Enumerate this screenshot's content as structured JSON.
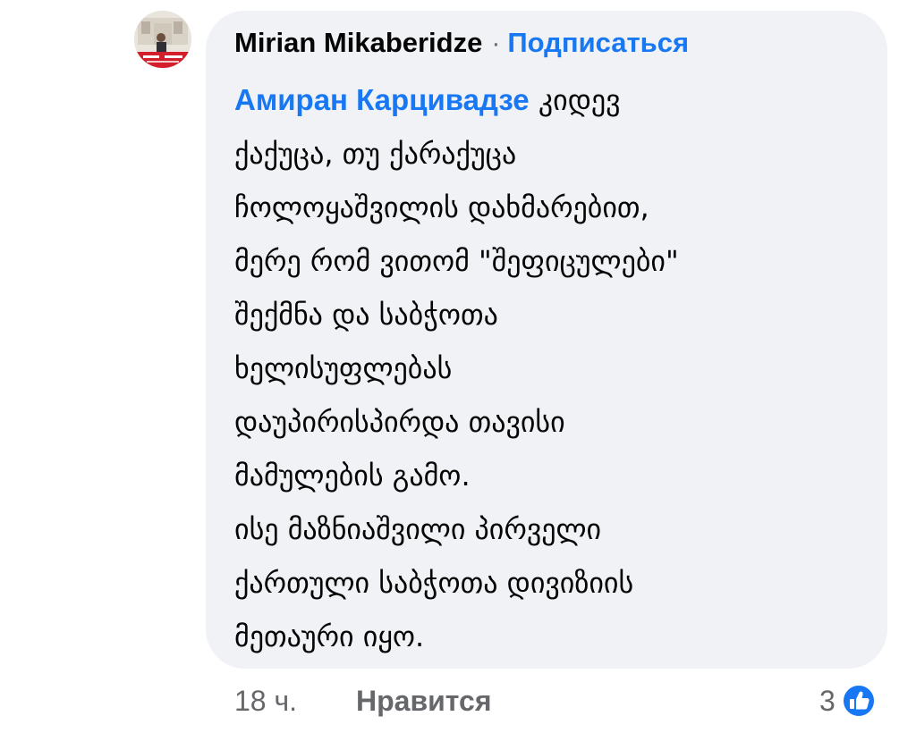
{
  "comment": {
    "author": "Mirian Mikaberidze",
    "separator": "·",
    "subscribe_label": "Подписаться",
    "mention": "Амиран Карцивадзе",
    "lines": [
      " კიდევ",
      "ქაქუცა, თუ ქარაქუცა",
      "ჩოლოყაშვილის დახმარებით,",
      "მერე რომ ვითომ \"შეფიცულები\"",
      "შექმნა და საბჭოთა",
      "ხელისუფლებას",
      "დაუპირისპირდა თავისი",
      "მამულების გამო.",
      "ისე მაზნიაშვილი პირველი",
      "ქართული საბჭოთა დივიზიის",
      "მეთაური იყო."
    ]
  },
  "footer": {
    "time": "18 ч.",
    "like_label": "Нравится",
    "reaction_count": "3"
  },
  "icons": {
    "avatar": "profile-photo",
    "reaction": "like-thumb-icon"
  },
  "colors": {
    "link": "#1877f2",
    "bubble": "#f0f2f5",
    "secondary_text": "#65676b",
    "primary_text": "#050505"
  }
}
